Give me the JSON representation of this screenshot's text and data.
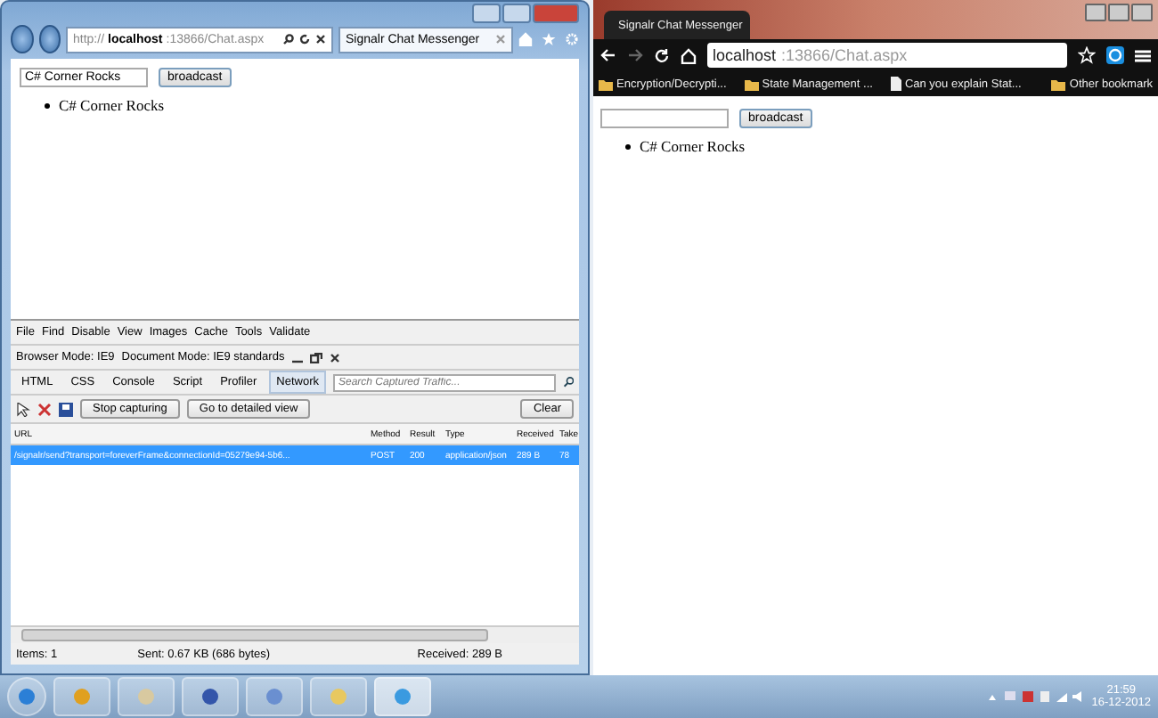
{
  "ie_window": {
    "address": "http://**localhost**:13866/Chat.aspx",
    "tab": "Signalr Chat Messenger",
    "page": {
      "input_value": "C# Corner Rocks",
      "button": "broadcast",
      "messages": [
        "C# Corner Rocks"
      ]
    },
    "devtools": {
      "menu": [
        "File",
        "Find",
        "Disable",
        "View",
        "Images",
        "Cache",
        "Tools",
        "Validate"
      ],
      "browser_mode": "Browser Mode: IE9",
      "document_mode": "Document Mode: IE9 standards",
      "tabs": [
        {
          "label": "HTML",
          "selected": false
        },
        {
          "label": "CSS",
          "selected": false
        },
        {
          "label": "Console",
          "selected": false
        },
        {
          "label": "Script",
          "selected": false
        },
        {
          "label": "Profiler",
          "selected": false
        },
        {
          "label": "Network",
          "selected": true
        }
      ],
      "search": {
        "placeholder": "Search Captured Traffic..."
      },
      "buttons": [
        "Stop capturing",
        "Go to detailed view"
      ],
      "clear_button": "Clear",
      "table": {
        "columns": [
          "URL",
          "Method",
          "Result",
          "Type",
          "Received",
          "Take"
        ],
        "rows": [
          {
            "cells": [
              "/signalr/send?transport=foreverFrame&connectionId=05279e94-5b6...",
              "POST",
              "200",
              "application/json",
              "289 B",
              "78"
            ],
            "selected": true
          }
        ]
      },
      "status_bar": {
        "items": "Items: 1",
        "sent": "Sent: 0.67 KB (686 bytes)",
        "received": "Received: 289 B"
      }
    }
  },
  "chrome_window": {
    "tab": "Signalr Chat Messenger",
    "address": "**localhost**:13866/Chat.aspx",
    "bookmarks": [
      {
        "label": "Encryption/Decrypti...",
        "kind": "folder"
      },
      {
        "label": "State Management ...",
        "kind": "folder"
      },
      {
        "label": "Can you explain Stat...",
        "kind": "page"
      }
    ],
    "other_bookmarks": "Other bookmark",
    "page": {
      "button": "broadcast",
      "messages": [
        "C# Corner Rocks"
      ]
    }
  },
  "taskbar": {
    "time": "21:59",
    "date": "16-12-2012"
  }
}
